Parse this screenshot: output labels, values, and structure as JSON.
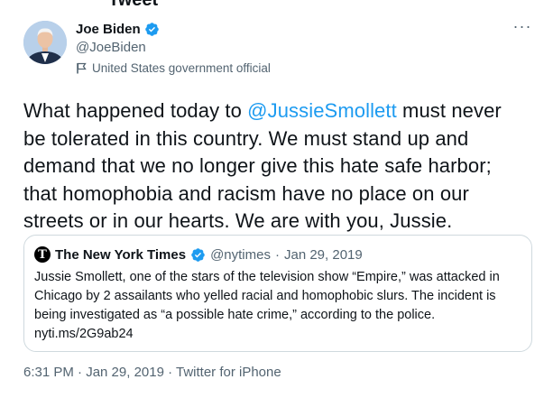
{
  "header": {
    "title": "Tweet"
  },
  "author": {
    "name": "Joe Biden",
    "handle": "@JoeBiden",
    "label": "United States government official"
  },
  "tweet": {
    "text_before": "What happened today to ",
    "mention": "@JussieSmollett",
    "text_after": " must never be tolerated in this country. We must stand up and demand that we no longer give this hate safe harbor; that homophobia and racism have no place on our streets or in our hearts. We are with you, Jussie."
  },
  "quote": {
    "avatar_letter": "T",
    "name": "The New York Times",
    "handle": "@nytimes",
    "separator": "·",
    "date": "Jan 29, 2019",
    "text": "Jussie Smollett, one of the stars of the television show “Empire,” was attacked in Chicago by 2 assailants who yelled racial and homophobic slurs. The incident is being investigated as “a possible hate crime,” according to the police.",
    "link": "nyti.ms/2G9ab24"
  },
  "footer": {
    "meta": "6:31 PM · Jan 29, 2019 · Twitter for iPhone"
  },
  "colors": {
    "accent": "#1d9bf0",
    "secondary": "#536471",
    "border": "#cfd9de"
  },
  "icons": {
    "verified": "verified-badge-icon",
    "label": "flag-icon",
    "more": "more-dots-icon"
  }
}
